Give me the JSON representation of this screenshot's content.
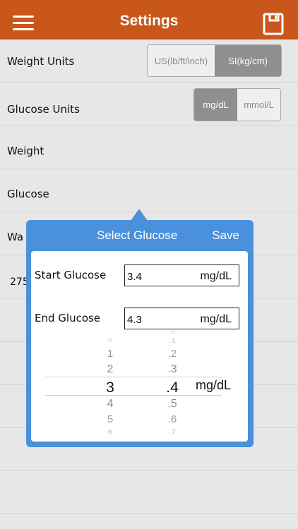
{
  "header": {
    "title": "Settings",
    "menu_icon": "hamburger-menu-icon",
    "save_icon": "floppy-disk-icon"
  },
  "settings": {
    "weight_units": {
      "label": "Weight Units",
      "options": [
        "US(lb/ft/inch)",
        "SI(kg/cm)"
      ],
      "selected": "SI(kg/cm)"
    },
    "glucose_units": {
      "label": "Glucose Units",
      "options": [
        "mg/dL",
        "mmol/L"
      ],
      "selected": "mg/dL"
    },
    "weight_label": "Weight",
    "glucose_label": "Glucose",
    "partial_row_1": "Wa",
    "partial_row_2": "275"
  },
  "popover": {
    "title": "Select Glucose",
    "save_label": "Save",
    "start": {
      "label": "Start Glucose",
      "value": "3.4",
      "unit": "mg/dL"
    },
    "end": {
      "label": "End Glucose",
      "value": "4.3",
      "unit": "mg/dL"
    },
    "picker": {
      "whole": [
        "0",
        "1",
        "2",
        "3",
        "4",
        "5",
        "6"
      ],
      "decimal": [
        ".0",
        ".1",
        ".2",
        ".3",
        ".4",
        ".5",
        ".6",
        ".7"
      ],
      "selected_whole": "3",
      "selected_decimal": ".4",
      "unit": "mg/dL"
    }
  },
  "colors": {
    "header": "#c9571b",
    "popover": "#4a90dc",
    "segment_selected": "#8f8f8f"
  }
}
